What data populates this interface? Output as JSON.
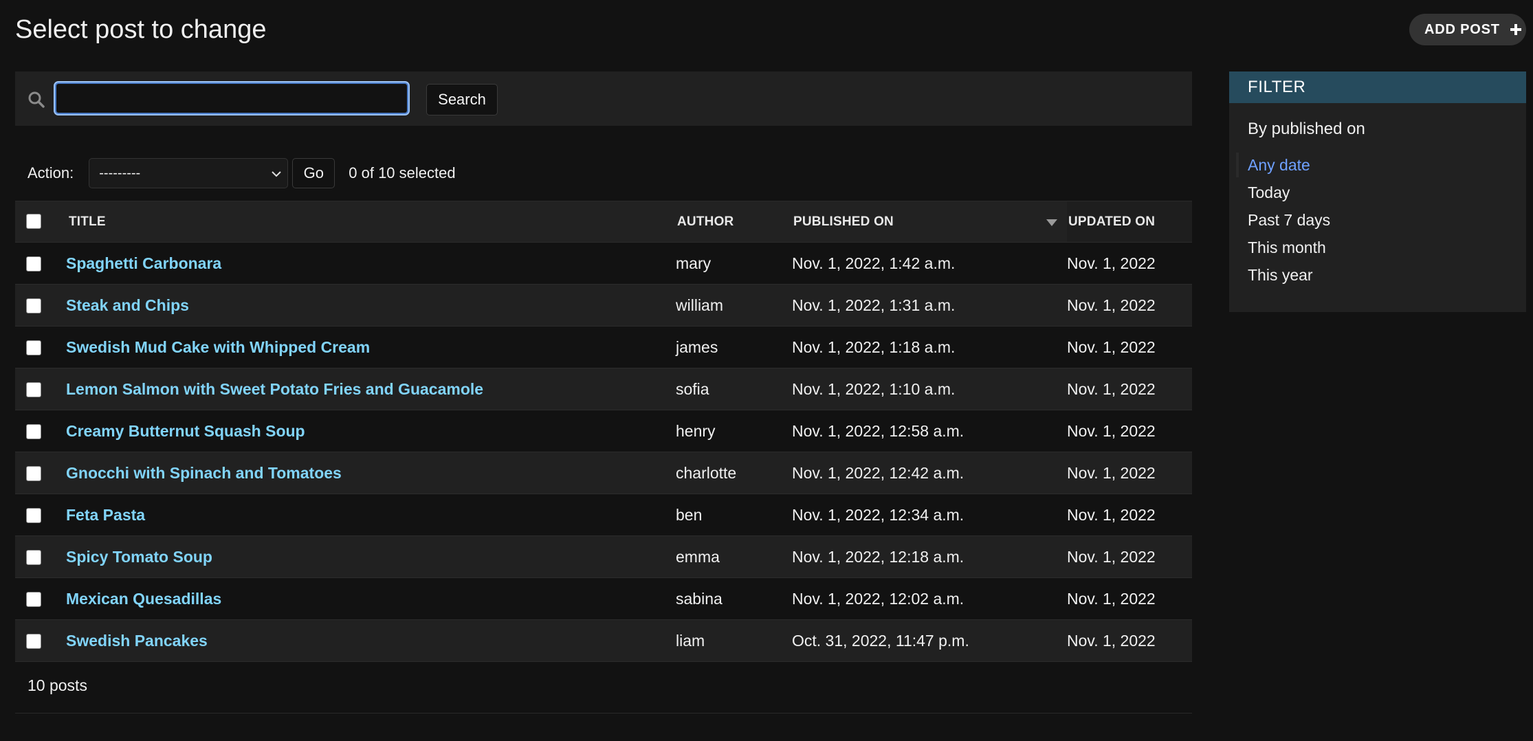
{
  "header": {
    "title": "Select post to change",
    "add_button_label": "ADD POST"
  },
  "search": {
    "value": "",
    "placeholder": "",
    "button_label": "Search"
  },
  "actions": {
    "label": "Action:",
    "selected_option": "---------",
    "go_label": "Go",
    "selection_counter": "0 of 10 selected"
  },
  "table": {
    "columns": [
      "TITLE",
      "AUTHOR",
      "PUBLISHED ON",
      "UPDATED ON"
    ],
    "sorted_column": "PUBLISHED ON",
    "sort_direction": "descending",
    "rows": [
      {
        "title": "Spaghetti Carbonara",
        "author": "mary",
        "published": "Nov. 1, 2022, 1:42 a.m.",
        "updated": "Nov. 1, 2022"
      },
      {
        "title": "Steak and Chips",
        "author": "william",
        "published": "Nov. 1, 2022, 1:31 a.m.",
        "updated": "Nov. 1, 2022"
      },
      {
        "title": "Swedish Mud Cake with Whipped Cream",
        "author": "james",
        "published": "Nov. 1, 2022, 1:18 a.m.",
        "updated": "Nov. 1, 2022"
      },
      {
        "title": "Lemon Salmon with Sweet Potato Fries and Guacamole",
        "author": "sofia",
        "published": "Nov. 1, 2022, 1:10 a.m.",
        "updated": "Nov. 1, 2022"
      },
      {
        "title": "Creamy Butternut Squash Soup",
        "author": "henry",
        "published": "Nov. 1, 2022, 12:58 a.m.",
        "updated": "Nov. 1, 2022"
      },
      {
        "title": "Gnocchi with Spinach and Tomatoes",
        "author": "charlotte",
        "published": "Nov. 1, 2022, 12:42 a.m.",
        "updated": "Nov. 1, 2022"
      },
      {
        "title": "Feta Pasta",
        "author": "ben",
        "published": "Nov. 1, 2022, 12:34 a.m.",
        "updated": "Nov. 1, 2022"
      },
      {
        "title": "Spicy Tomato Soup",
        "author": "emma",
        "published": "Nov. 1, 2022, 12:18 a.m.",
        "updated": "Nov. 1, 2022"
      },
      {
        "title": "Mexican Quesadillas",
        "author": "sabina",
        "published": "Nov. 1, 2022, 12:02 a.m.",
        "updated": "Nov. 1, 2022"
      },
      {
        "title": "Swedish Pancakes",
        "author": "liam",
        "published": "Oct. 31, 2022, 11:47 p.m.",
        "updated": "Nov. 1, 2022"
      }
    ]
  },
  "paginator": {
    "text": "10 posts"
  },
  "filter": {
    "header": "FILTER",
    "group_title": "By published on",
    "options": [
      {
        "label": "Any date",
        "selected": true
      },
      {
        "label": "Today",
        "selected": false
      },
      {
        "label": "Past 7 days",
        "selected": false
      },
      {
        "label": "This month",
        "selected": false
      },
      {
        "label": "This year",
        "selected": false
      }
    ]
  },
  "colors": {
    "background": "#121212",
    "row_alt": "#212121",
    "link": "#81d4fa",
    "filter_header": "#264b5d",
    "selected_filter": "#6fa1ff"
  }
}
